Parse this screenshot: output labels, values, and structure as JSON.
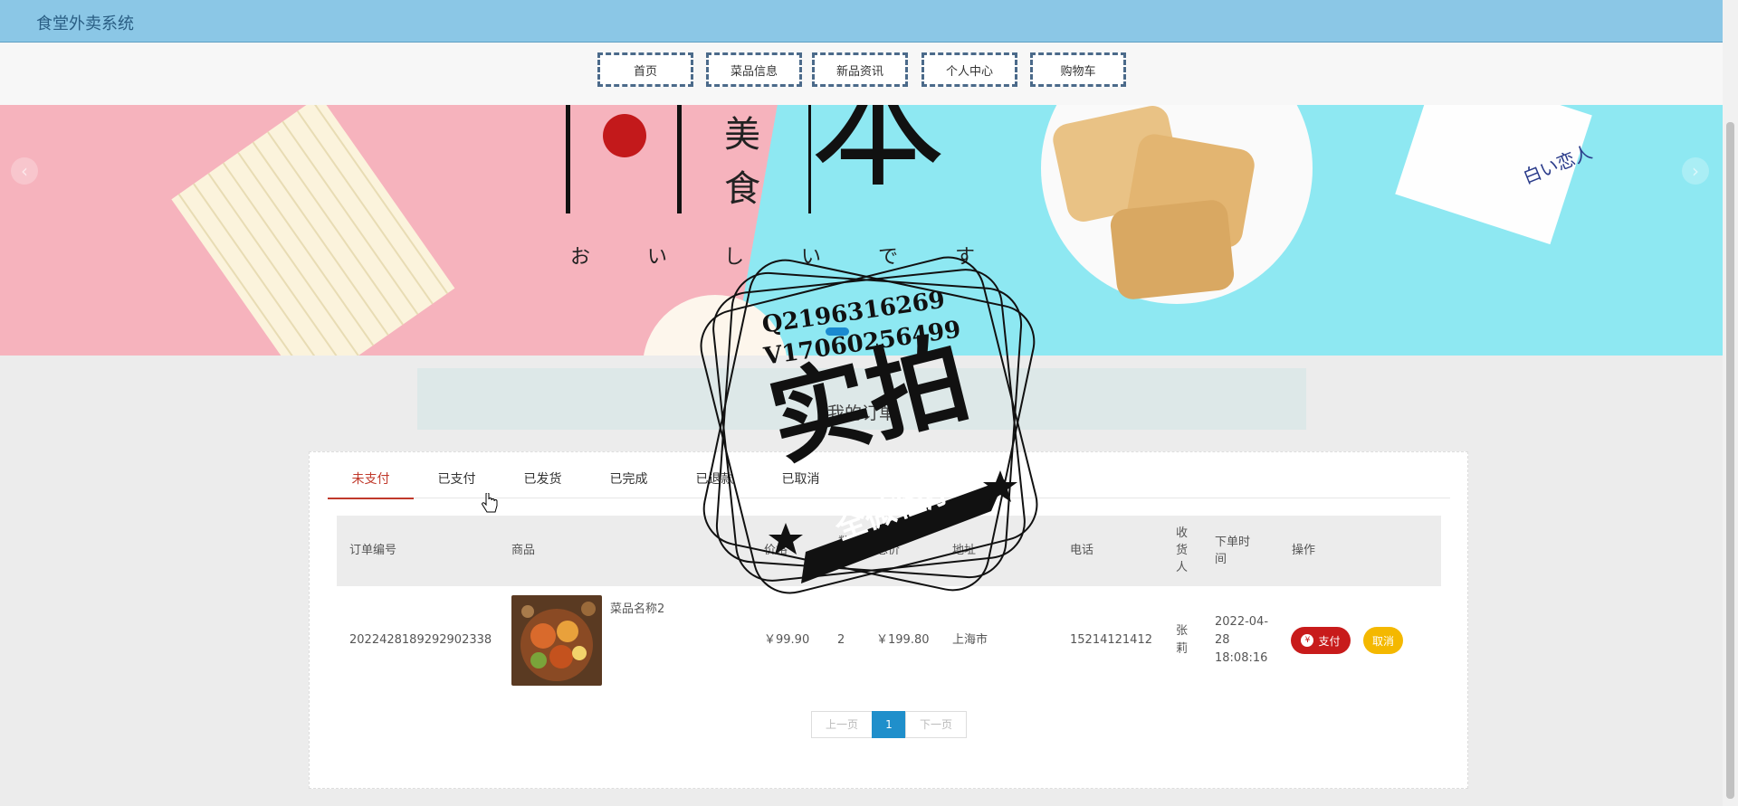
{
  "app": {
    "title": "食堂外卖系统"
  },
  "nav": {
    "items": [
      {
        "label": "首页"
      },
      {
        "label": "菜品信息"
      },
      {
        "label": "新品资讯"
      },
      {
        "label": "个人中心"
      },
      {
        "label": "购物车"
      }
    ]
  },
  "banner": {
    "glyph_left": "日",
    "glyph_small": [
      "美",
      "食"
    ],
    "glyph_right": "本",
    "kana": "お い し い で す",
    "package_text": "白い恋人"
  },
  "page": {
    "title": "我的订单"
  },
  "tabs": [
    {
      "label": "未支付",
      "active": true
    },
    {
      "label": "已支付"
    },
    {
      "label": "已发货"
    },
    {
      "label": "已完成"
    },
    {
      "label": "已退款"
    },
    {
      "label": "已取消"
    }
  ],
  "table": {
    "headers": {
      "order_no": "订单编号",
      "product": "商品",
      "price": "价格",
      "qty": "数量",
      "total": "总价",
      "address": "地址",
      "phone": "电话",
      "receiver": "收货人",
      "time": "下单时间",
      "action": "操作"
    },
    "rows": [
      {
        "order_no": "2022428189292902338",
        "product_name": "菜品名称2",
        "price": "￥99.90",
        "qty": "2",
        "total": "￥199.80",
        "address": "上海市",
        "phone": "15214121412",
        "receiver": "张莉",
        "time": "2022-04-28 18:08:16",
        "pay_label": "支付",
        "cancel_label": "取消"
      }
    ]
  },
  "pagination": {
    "prev": "上一页",
    "current": "1",
    "next": "下一页"
  },
  "watermark": {
    "line1": "Q2196316269",
    "line2": "V17060256499",
    "big": "实拍",
    "ribbon": "全微程序"
  },
  "colors": {
    "topbar": "#8bc7e6",
    "active_tab": "#c0392b",
    "pay_button": "#c81b1b",
    "cancel_button": "#f4b800",
    "page_current": "#1f8fcb"
  }
}
